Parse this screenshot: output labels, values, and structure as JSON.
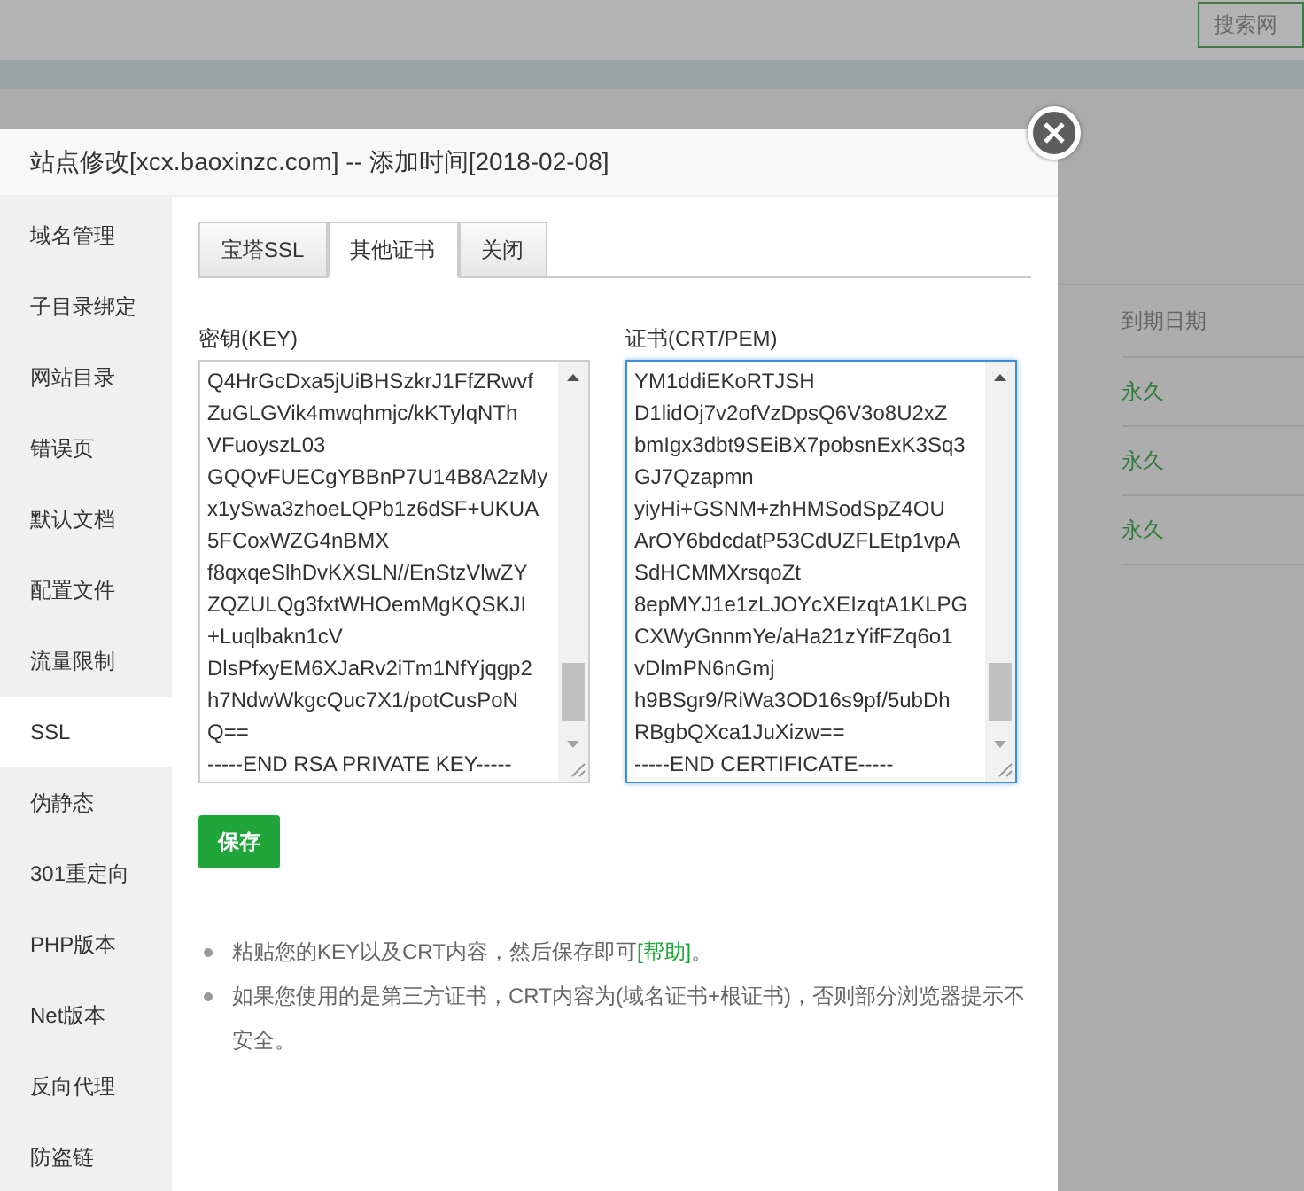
{
  "background": {
    "search": {
      "placeholder": "搜索网"
    },
    "table": {
      "header": "到期日期",
      "rows": [
        "永久",
        "永久",
        "永久"
      ]
    }
  },
  "dialog": {
    "title": "站点修改[xcx.baoxinzc.com] -- 添加时间[2018-02-08]",
    "sidebar": [
      {
        "label": "域名管理",
        "selected": false
      },
      {
        "label": "子目录绑定",
        "selected": false
      },
      {
        "label": "网站目录",
        "selected": false
      },
      {
        "label": "错误页",
        "selected": false
      },
      {
        "label": "默认文档",
        "selected": false
      },
      {
        "label": "配置文件",
        "selected": false
      },
      {
        "label": "流量限制",
        "selected": false
      },
      {
        "label": "SSL",
        "selected": true
      },
      {
        "label": "伪静态",
        "selected": false
      },
      {
        "label": "301重定向",
        "selected": false
      },
      {
        "label": "PHP版本",
        "selected": false
      },
      {
        "label": "Net版本",
        "selected": false
      },
      {
        "label": "反向代理",
        "selected": false
      },
      {
        "label": "防盗链",
        "selected": false
      }
    ],
    "tabs": [
      {
        "label": "宝塔SSL",
        "selected": false
      },
      {
        "label": "其他证书",
        "selected": true
      },
      {
        "label": "关闭",
        "selected": false
      }
    ],
    "fields": [
      {
        "label": "密钥(KEY)",
        "focused": false,
        "lines": [
          "Q4HrGcDxa5jUiBHSzkrJ1FfZRwvf",
          "ZuGLGVik4mwqhmjc/kKTylqNTh",
          "VFuoyszL03",
          "GQQvFUECgYBBnP7U14B8A2zMy",
          "x1ySwa3zhoeLQPb1z6dSF+UKUA",
          "5FCoxWZG4nBMX",
          "f8qxqeSlhDvKXSLN//EnStzVlwZY",
          "ZQZULQg3fxtWHOemMgKQSKJI",
          "+Luqlbakn1cV",
          "DlsPfxyEM6XJaRv2iTm1NfYjqgp2",
          "h7NdwWkgcQuc7X1/potCusPoN",
          "Q==",
          "-----END RSA PRIVATE KEY-----"
        ]
      },
      {
        "label": "证书(CRT/PEM)",
        "focused": true,
        "lines": [
          "YM1ddiEKoRTJSH",
          "D1lidOj7v2ofVzDpsQ6V3o8U2xZ",
          "bmIgx3dbt9SEiBX7pobsnExK3Sq3",
          "GJ7Qzapmn",
          "yiyHi+GSNM+zhHMSodSpZ4OU",
          "ArOY6bdcdatP53CdUZFLEtp1vpA",
          "SdHCMMXrsqoZt",
          "8epMYJ1e1zLJOYcXEIzqtA1KLPG",
          "CXWyGnnmYe/aHa21zYifFZq6o1",
          "vDlmPN6nGmj",
          "h9BSgr9/RiWa3OD16s9pf/5ubDh",
          "RBgbQXca1JuXizw==",
          "-----END CERTIFICATE-----"
        ]
      }
    ],
    "save_button": "保存",
    "notes": [
      {
        "text": "粘贴您的KEY以及CRT内容，然后保存即可",
        "link": "[帮助]",
        "after": "。"
      },
      {
        "text": "如果您使用的是第三方证书，CRT内容为(域名证书+根证书)，否则部分浏览器提示不安全。"
      }
    ]
  }
}
